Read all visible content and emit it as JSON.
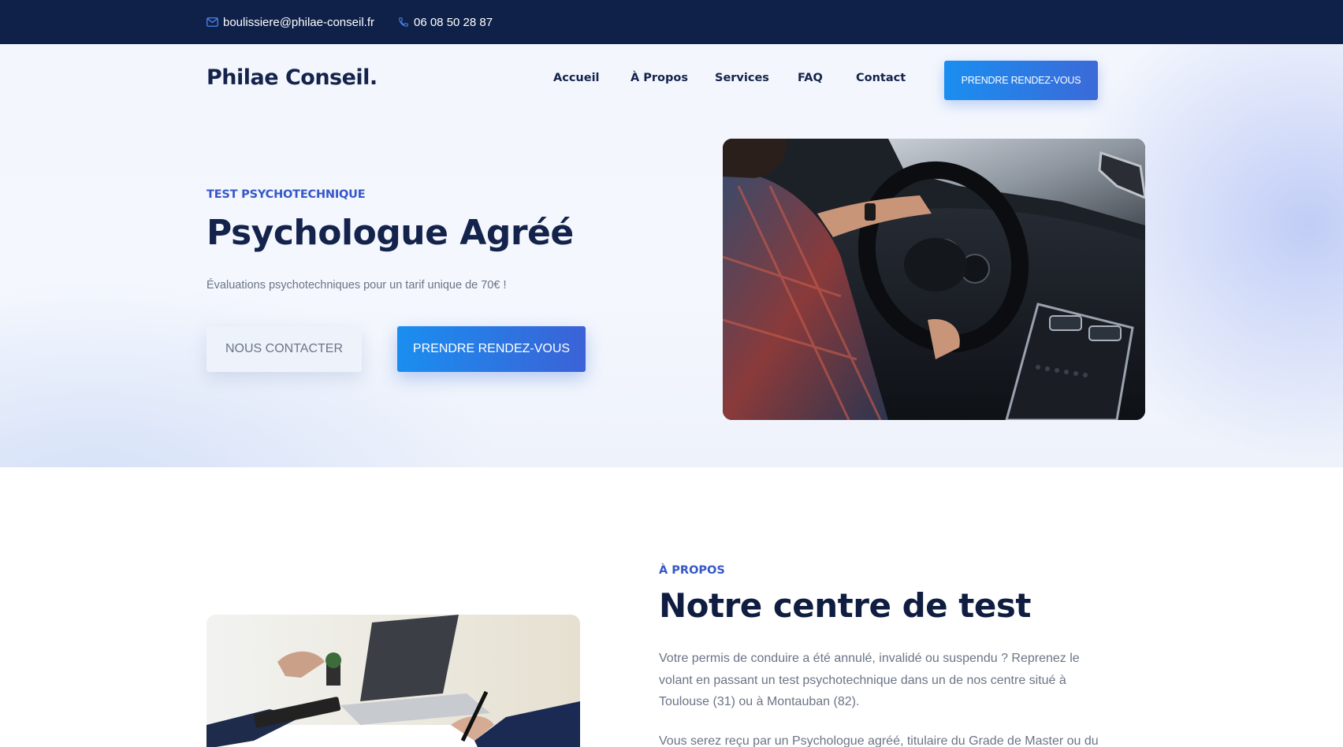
{
  "topbar": {
    "email": "boulissiere@philae-conseil.fr",
    "phone": "06 08 50 28 87",
    "email_icon": "mail-icon",
    "phone_icon": "phone-icon"
  },
  "header": {
    "logo": "Philae Conseil.",
    "nav": [
      "Accueil",
      "À Propos",
      "Services",
      "FAQ",
      "Contact"
    ],
    "cta": "PRENDRE RENDEZ-VOUS"
  },
  "hero": {
    "eyebrow": "TEST PSYCHOTECHNIQUE",
    "title": "Psychologue Agréé",
    "subtitle": "Évaluations psychotechniques pour un tarif unique de 70€ !",
    "btn_contact": "NOUS CONTACTER",
    "btn_rdv": "PRENDRE RENDEZ-VOUS"
  },
  "about": {
    "eyebrow": "À PROPOS",
    "title": "Notre centre de test",
    "paragraph1": "Votre permis de conduire a été annulé, invalidé ou suspendu ? Reprenez le volant en passant un test psychotechnique dans un de nos centre situé à Toulouse (31) ou à Montauban (82).",
    "paragraph2": "Vous serez reçu par un Psychologue agréé, titulaire du Grade de Master ou du"
  },
  "colors": {
    "navy": "#0f2149",
    "accent_blue": "#3557c8",
    "button_gradient_start": "#1a8ef0",
    "button_gradient_end": "#3b62d6"
  }
}
